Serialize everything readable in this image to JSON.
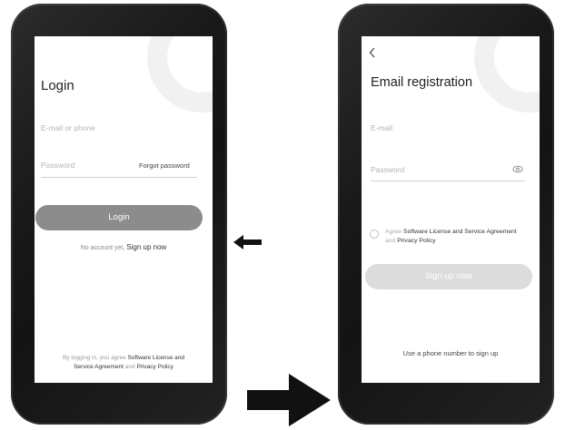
{
  "login_screen": {
    "title": "Login",
    "email_placeholder": "E-mail or phone",
    "password_placeholder": "Password",
    "forgot_password": "Forgot password",
    "login_button": "Login",
    "no_account_text": "No account yet,",
    "sign_up_link": "Sign up now",
    "footer_prefix": "By logging in, you agree",
    "footer_license": "Software License and",
    "footer_license_2": "Service Agreement",
    "footer_and": "and",
    "footer_privacy": "Privacy Policy"
  },
  "registration_screen": {
    "back_icon": "chevron-left-icon",
    "title": "Email registration",
    "email_placeholder": "E-mail",
    "password_placeholder": "Password",
    "password_toggle_icon": "eye-icon",
    "agree_prefix": "Agree",
    "agree_license": "Software License and Service Agreement",
    "agree_and": "and",
    "agree_privacy": "Privacy Policy",
    "signup_button": "Sign up now",
    "phone_signup_link": "Use a phone number to sign up"
  },
  "colors": {
    "login_button": "#8c8c8c",
    "signup_button_disabled": "#dcdcdc"
  },
  "arrows": {
    "small_arrow_icon": "arrow-left-icon",
    "big_arrow_icon": "arrow-right-icon"
  }
}
